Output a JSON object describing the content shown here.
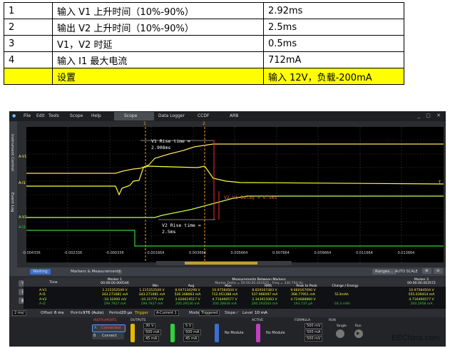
{
  "spec_table": {
    "rows": [
      {
        "idx": "1",
        "item": "输入 V1 上升时间（10%-90%）",
        "value": "2.92ms"
      },
      {
        "idx": "2",
        "item": "输出 V2 上升时间（10%-90%）",
        "value": "2.5ms"
      },
      {
        "idx": "3",
        "item": "V1，V2 时延",
        "value": "0.5ms"
      },
      {
        "idx": "4",
        "item": "输入 I1  最大电流",
        "value": "712mA"
      },
      {
        "idx": "",
        "item": "设置",
        "value": "输入 12V，负载-200mA"
      }
    ]
  },
  "scope": {
    "menu": [
      "File",
      "Edit",
      "Tools",
      "Scope",
      "Help"
    ],
    "tabs": [
      "Scope",
      "Data Logger",
      "CCDF",
      "ARB"
    ],
    "side_tabs": [
      "Instrument Control",
      "Event Log"
    ],
    "channel_labels": [
      "A-V1",
      "A-I1",
      "A-V2",
      "A-I2"
    ],
    "annotations": {
      "v1_rise": "V1 Rise time =\n2.908ms",
      "v2_delay": "V2-V1 Delay = 0.5ms",
      "v2_rise": "V2 Rise time =\n2.5ms"
    },
    "marker_labels": [
      "1",
      "2"
    ],
    "time_ticks": [
      "-0.004336",
      "-0.002336",
      "-0.000336",
      "0.001664",
      "0.003664",
      "0.005664",
      "0.007664",
      "0.009664",
      "0.011664",
      "0.013664"
    ],
    "meas": {
      "waiting": "Waiting",
      "title": "Markers & Measurements",
      "ranges": "Ranges...",
      "autoscale": "AUTO SCALE",
      "marker1": "Marker 1",
      "marker1_t": "00:00:00.000546",
      "between_title": "Measurements Between Markers",
      "between_sub": "Marker Delta = 00:00:00.003025 · Freq = 330.794 Hz",
      "marker2": "Marker 2",
      "marker2_t": "00:00:00.003572",
      "cols": [
        "Time",
        "Min",
        "Avg",
        "Max",
        "RMS",
        "Peak to Peak",
        "Charge / Energy"
      ],
      "rows": [
        {
          "name": "A-V1",
          "m1": "1.215352549 V",
          "min": "1.215352549 V",
          "avg": "8.047130298 V",
          "max": "10.97584504 V",
          "rms": "8.829167483 V",
          "p2p": "9.660167090 V",
          "ce": "",
          "m2": "10.97584504 V"
        },
        {
          "name": "A-I1",
          "m1": "343.271681 mA",
          "min": "343.271681 mA",
          "avg": "526.308663 mA",
          "max": "712.051388 mA",
          "rms": "537.966097 mA",
          "p2p": "368.77951 mA",
          "ce": "513mAh",
          "m2": "555.039414 mA"
        },
        {
          "name": "A-V2",
          "m1": "-10.32000 mV",
          "min": "-10.31775 mV",
          "avg": "3.026619517 V",
          "max": "4.716490577 V",
          "rms": "2.343915083 V",
          "p2p": "4.724688880 V",
          "ce": "",
          "m2": "4.716490577 V"
        },
        {
          "name": "A-I2",
          "m1": "199.7927 mA",
          "min": "199.7927 mA",
          "avg": "200.29536 mA",
          "max": "200.28830 mA",
          "rms": "200.293503 mA",
          "p2p": "193.737 µA",
          "ce": "-16.3 mAh",
          "m2": "200.2958 mA"
        }
      ]
    },
    "controls": {
      "timebase": "2 ms/",
      "offset_label": "Offset",
      "offset": "6 ms",
      "points_label": "Points",
      "points": "976 (Auto)",
      "period_label": "Period",
      "period": "20 µs",
      "trigger_label": "Trigger",
      "trigger": "A-Current 1",
      "mode_label": "Mode",
      "mode": "Triggered",
      "slope_label": "Slope",
      "level_label": "Level",
      "level": "10 mA"
    },
    "bottom": {
      "instruments": "INSTRUMENTS",
      "connected": "Connected",
      "connect": "Connect",
      "outputs": "OUTPUTS",
      "active": "ACTIVE",
      "formula": "FORMULA",
      "run": "RUN",
      "single": "Single",
      "run_btn": "Run",
      "ch1": {
        "v": "30 V",
        "i": "500 mA",
        "ii": "45 mA"
      },
      "ch2": {
        "v": "5 V",
        "i": "500 mA",
        "ii": "45 mA"
      },
      "no_module_1": "No Module",
      "no_module_2": "No Module",
      "formula_vals": [
        "500 mV",
        "500 mA",
        "500 mV"
      ]
    },
    "colors": {
      "v1": "#ffe35c",
      "i1": "#ffff33",
      "v2": "#c8ff4a",
      "i2": "#2fd23a",
      "marker": "#f0a020",
      "redline": "#ff2a2a"
    }
  },
  "watermark": "EEChina.com"
}
